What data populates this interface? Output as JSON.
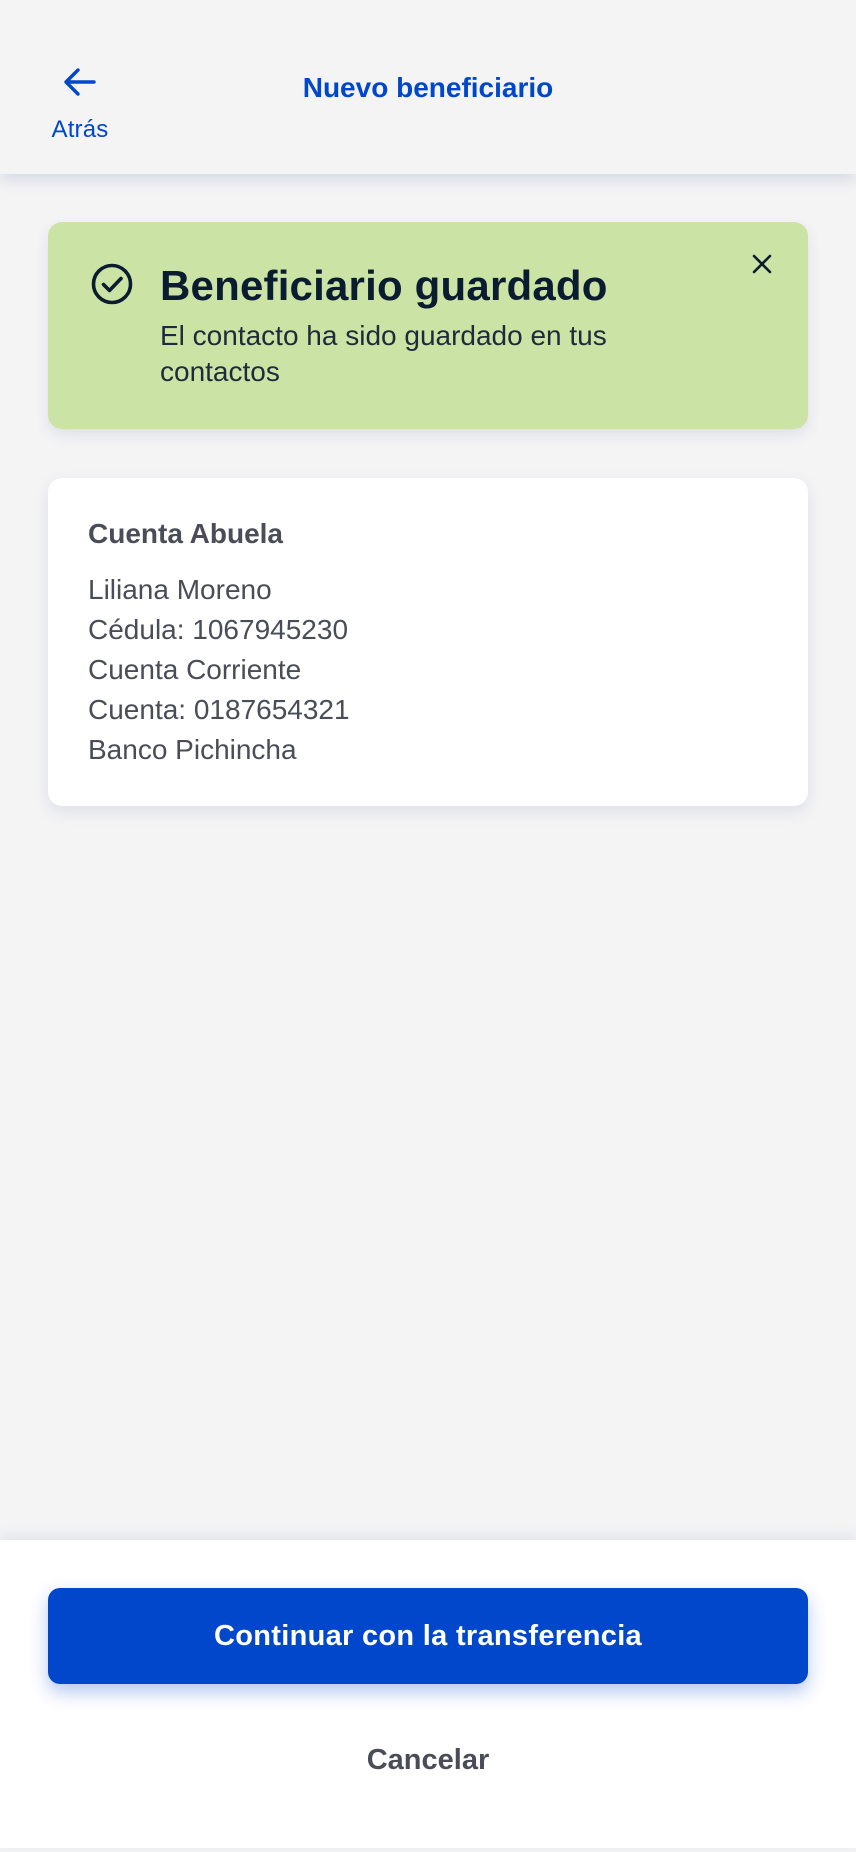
{
  "header": {
    "back_label": "Atrás",
    "title": "Nuevo beneficiario"
  },
  "banner": {
    "title": "Beneficiario guardado",
    "message": "El contacto ha sido guardado en tus contactos",
    "icon": "check-circle-icon",
    "close_icon": "close-icon",
    "background_color": "#cbe4a6"
  },
  "contact": {
    "alias": "Cuenta Abuela",
    "lines": [
      "Liliana Moreno",
      "Cédula: 1067945230",
      "Cuenta Corriente",
      "Cuenta: 0187654321",
      "Banco Pichincha"
    ]
  },
  "actions": {
    "primary_label": "Continuar con la transferencia",
    "secondary_label": "Cancelar"
  },
  "colors": {
    "accent": "#0047cc",
    "background": "#f4f4f5",
    "text_muted": "#4a4d58"
  }
}
